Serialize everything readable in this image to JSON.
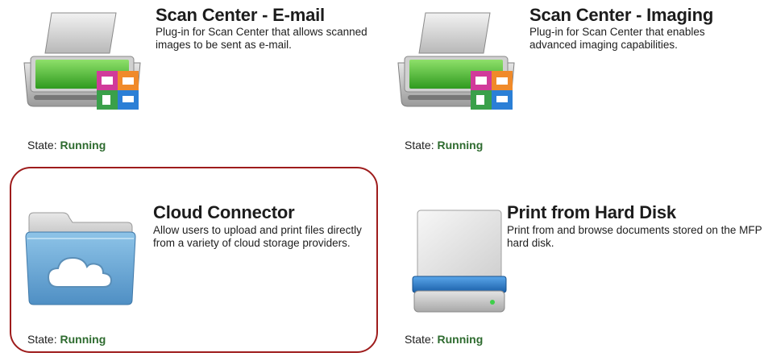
{
  "plugins": [
    {
      "title": "Scan Center - E-mail",
      "description": "Plug-in for Scan Center that allows scanned images to be sent as e-mail.",
      "state_label": "State:",
      "state_value": "Running",
      "icon": "scanner-icon"
    },
    {
      "title": "Scan Center - Imaging",
      "description": "Plug-in for Scan Center that enables advanced imaging capabilities.",
      "state_label": "State:",
      "state_value": "Running",
      "icon": "scanner-icon"
    },
    {
      "title": "Cloud Connector",
      "description": "Allow users to upload and print files directly from a variety of cloud storage providers.",
      "state_label": "State:",
      "state_value": "Running",
      "icon": "cloud-folder-icon"
    },
    {
      "title": "Print from Hard Disk",
      "description": "Print from and browse documents stored on the MFP hard disk.",
      "state_label": "State:",
      "state_value": "Running",
      "icon": "hard-disk-icon"
    }
  ],
  "colors": {
    "state_running": "#2e6b2f",
    "highlight_border": "#9e1c1c"
  }
}
